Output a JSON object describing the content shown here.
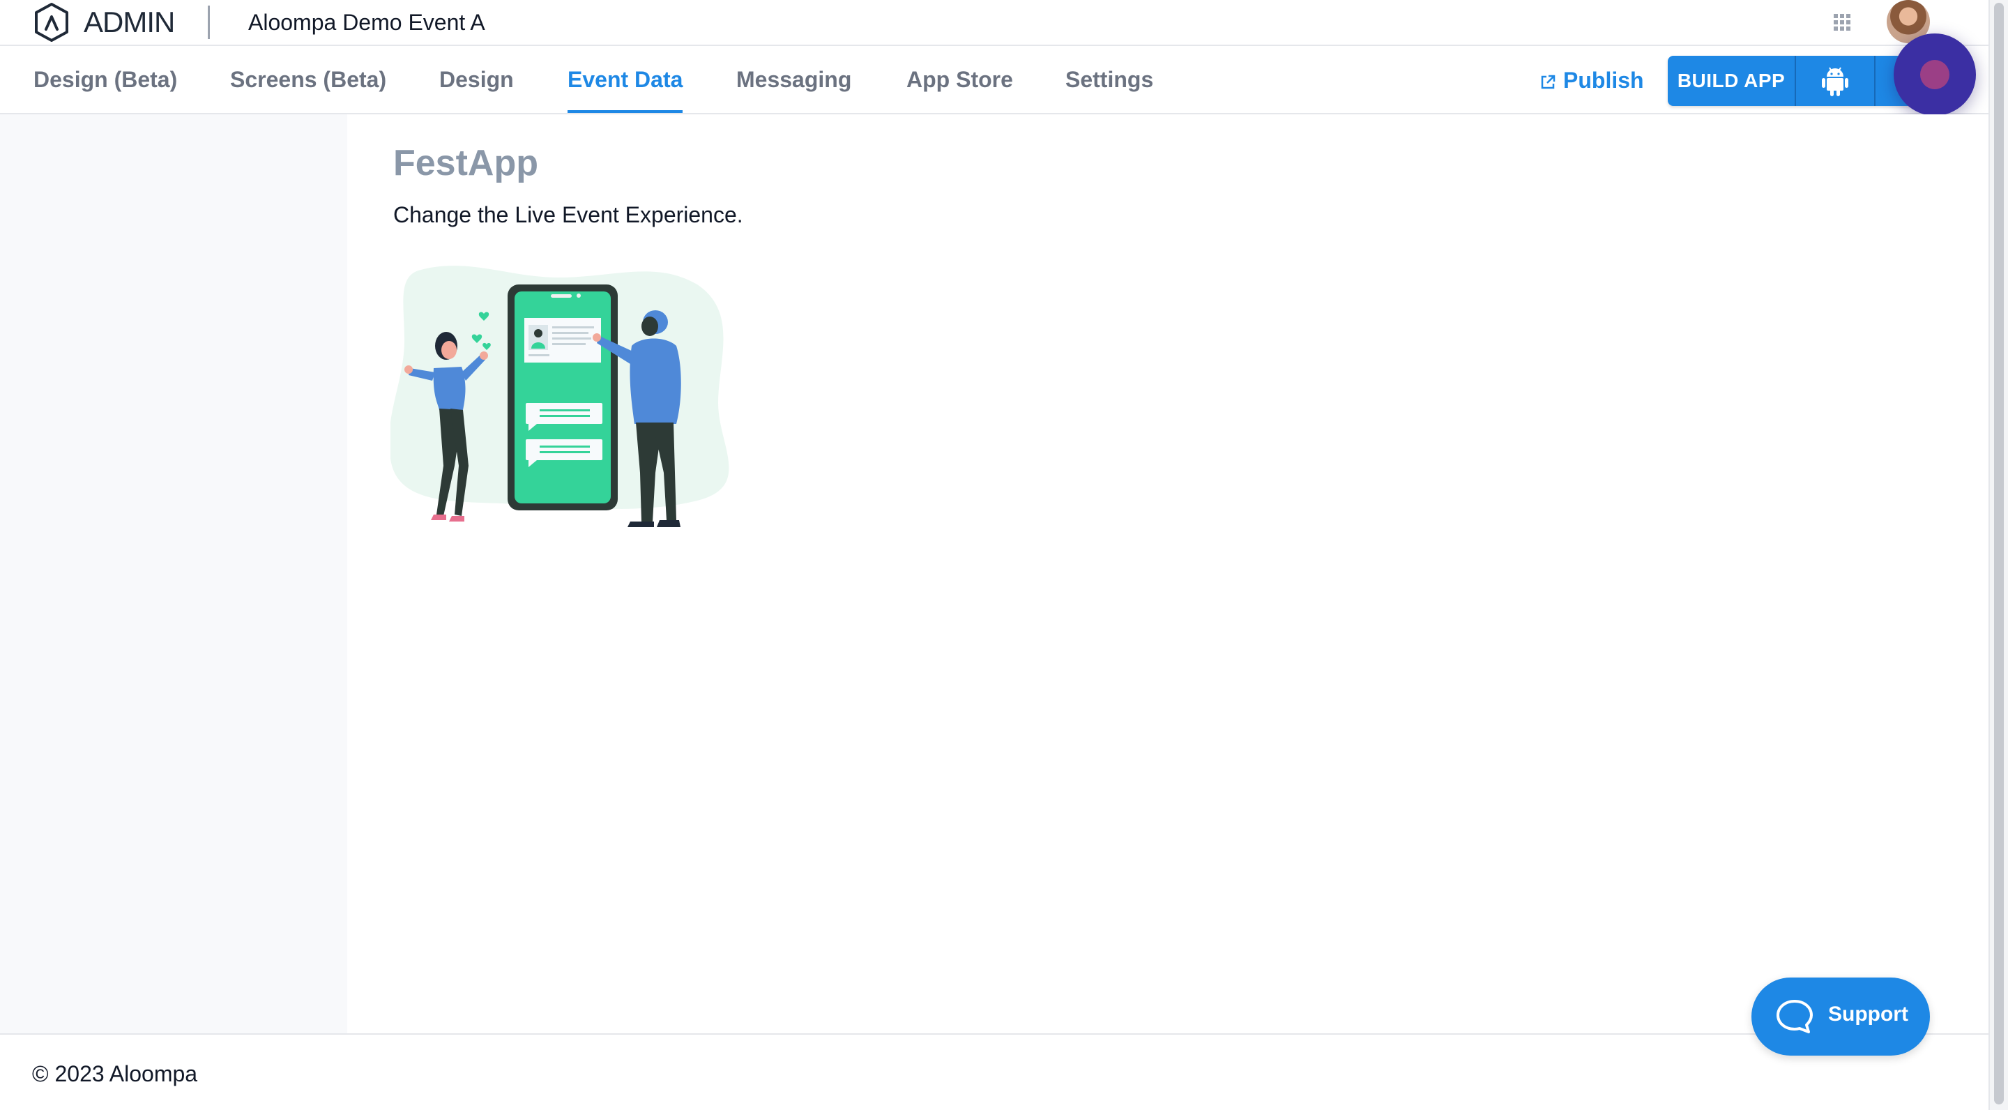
{
  "header": {
    "app_name": "ADMIN",
    "event_name": "Aloompa Demo Event A",
    "icons": {
      "logo": "aloompa-logo-icon",
      "apps": "apps-grid-icon",
      "avatar": "user-avatar"
    }
  },
  "tabs": [
    {
      "label": "Design (Beta)",
      "active": false
    },
    {
      "label": "Screens (Beta)",
      "active": false
    },
    {
      "label": "Design",
      "active": false
    },
    {
      "label": "Event Data",
      "active": true
    },
    {
      "label": "Messaging",
      "active": false
    },
    {
      "label": "App Store",
      "active": false
    },
    {
      "label": "Settings",
      "active": false
    }
  ],
  "actions": {
    "publish_label": "Publish",
    "build_label": "BUILD APP",
    "icons": {
      "publish": "external-link-icon",
      "android": "android-icon",
      "ios": "apple-icon"
    }
  },
  "main": {
    "title": "FestApp",
    "subtitle": "Change the Live Event Experience."
  },
  "footer": {
    "copyright": "© 2023 Aloompa"
  },
  "support": {
    "label": "Support",
    "icon": "chat-bubble-icon"
  },
  "colors": {
    "accent": "#1e88e5",
    "title_gray": "#8a97a8",
    "sidebar_bg": "#f8f9fb",
    "illustration_green": "#34d399",
    "record_overlay": "#3b2fa3"
  }
}
